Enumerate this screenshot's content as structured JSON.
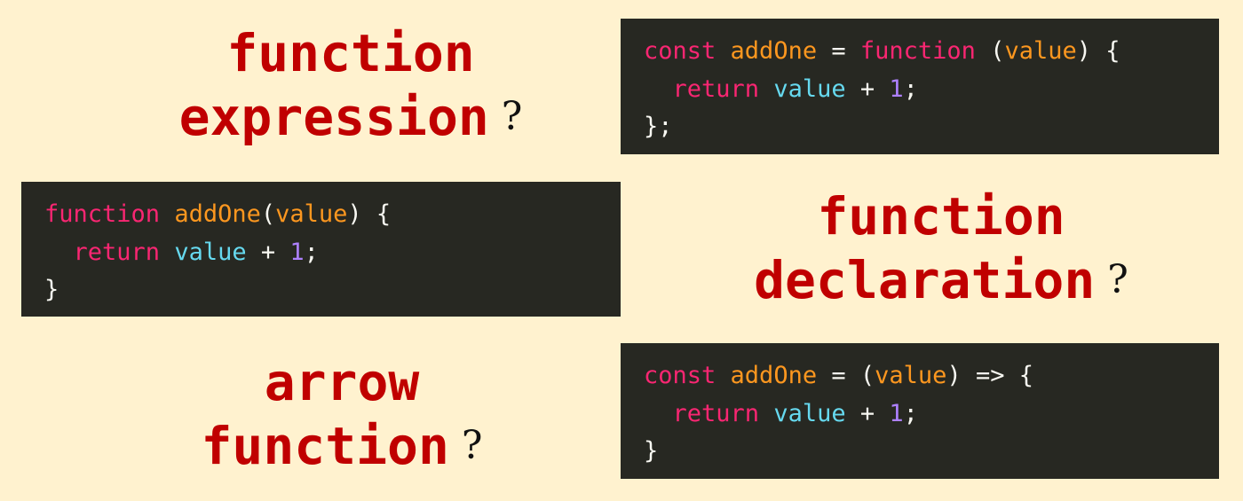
{
  "labels": {
    "expression": {
      "line1": "function",
      "line2": "expression",
      "mark": "?"
    },
    "declaration": {
      "line1": "function",
      "line2": "declaration",
      "mark": "?"
    },
    "arrow": {
      "line1": "arrow",
      "line2": "function",
      "mark": "?"
    }
  },
  "code": {
    "expression": {
      "line1": {
        "kw": "const",
        "name": "addOne",
        "eq": "=",
        "kw2": "function",
        "open": "(",
        "param": "value",
        "close": ") {"
      },
      "line2": {
        "kw": "return",
        "var": "value",
        "op": "+",
        "num": "1",
        "end": ";"
      },
      "line3": "};"
    },
    "declaration": {
      "line1": {
        "kw": "function",
        "name": "addOne",
        "open": "(",
        "param": "value",
        "close": ") {"
      },
      "line2": {
        "kw": "return",
        "var": "value",
        "op": "+",
        "num": "1",
        "end": ";"
      },
      "line3": "}"
    },
    "arrow": {
      "line1": {
        "kw": "const",
        "name": "addOne",
        "eq": "=",
        "open": "(",
        "param": "value",
        "close": ") => {"
      },
      "line2": {
        "kw": "return",
        "var": "value",
        "op": "+",
        "num": "1",
        "end": ";"
      },
      "line3": "}"
    }
  },
  "colors": {
    "background": "#fff2cf",
    "label": "#c00000",
    "code_background": "#272822",
    "keyword": "#f92672",
    "function_name": "#fd971f",
    "parameter": "#fd971f",
    "variable": "#66d9ef",
    "number": "#ae81ff",
    "punctuation": "#f8f8f2"
  }
}
